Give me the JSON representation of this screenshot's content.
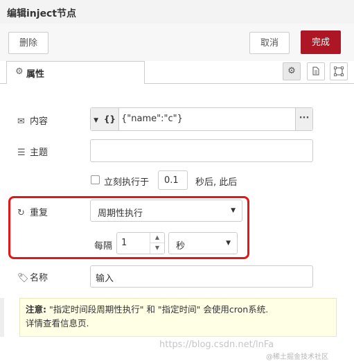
{
  "title": "编辑inject节点",
  "buttons": {
    "delete": "删除",
    "cancel": "取消",
    "done": "完成"
  },
  "tab": {
    "label": "属性",
    "icon": "gear-icon"
  },
  "tab_icons": [
    "gear-icon",
    "document-icon",
    "frame-icon"
  ],
  "fields": {
    "payload": {
      "label": "内容",
      "icon": "envelope-icon",
      "type_label": "{}",
      "value": "{\"name\":\"c\"}"
    },
    "topic": {
      "label": "主题",
      "icon": "tasks-icon",
      "value": ""
    },
    "once": {
      "label": "立刻执行于",
      "delay": "0.1",
      "suffix": "秒后, 此后"
    },
    "repeat": {
      "label": "重复",
      "icon": "refresh-icon",
      "mode": "周期性执行",
      "every_label": "每隔",
      "every_value": "1",
      "unit": "秒"
    },
    "name": {
      "label": "名称",
      "icon": "tag-icon",
      "placeholder": "输入"
    }
  },
  "note": {
    "bold": "注意:",
    "text1": " \"指定时间段周期性执行\" 和 \"指定时间\" 会使用cron系统.",
    "text2": "详情查看信息页."
  },
  "watermark": "https://blog.csdn.net/lnFa",
  "watermark2": "@稀土掘金技术社区",
  "colors": {
    "done_button": "#ad1625",
    "highlight_border": "#e01818",
    "note_bg": "#ffffe5"
  }
}
